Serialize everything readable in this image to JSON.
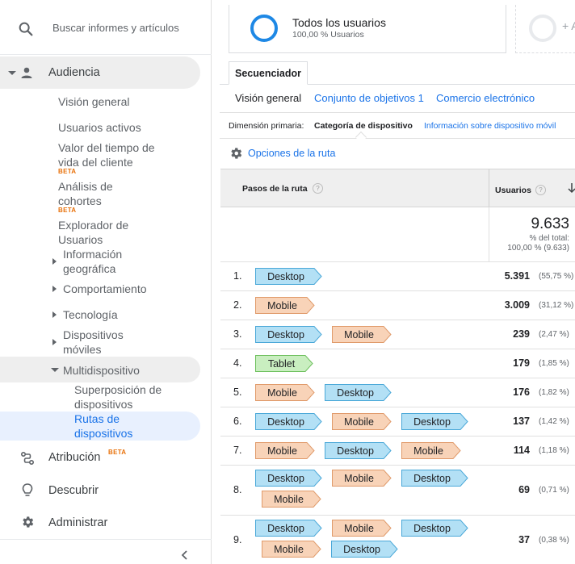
{
  "search": {
    "placeholder": "Buscar informes y artículos"
  },
  "sidebar": {
    "audiencia": "Audiencia",
    "items": [
      {
        "label": "Visión general"
      },
      {
        "label": "Usuarios activos"
      },
      {
        "label": "Valor del tiempo de vida del cliente",
        "beta": "BETA"
      },
      {
        "label": "Análisis de cohortes",
        "beta": "BETA"
      },
      {
        "label": "Explorador de Usuarios"
      },
      {
        "label": "Información geográfica"
      },
      {
        "label": "Comportamiento"
      },
      {
        "label": "Tecnología"
      },
      {
        "label": "Dispositivos móviles"
      },
      {
        "label": "Multidispositivo"
      },
      {
        "label": "Superposición de dispositivos"
      },
      {
        "label": "Rutas de dispositivos"
      }
    ],
    "atribucion": "Atribución",
    "atribucion_beta": "BETA",
    "descubrir": "Descubrir",
    "administrar": "Administrar"
  },
  "segment": {
    "name": "Todos los usuarios",
    "pct": "100,00 % Usuarios",
    "add": "+ A"
  },
  "tabs": {
    "main": "Secuenciador",
    "sub": [
      "Visión general",
      "Conjunto de objetivos 1",
      "Comercio electrónico"
    ]
  },
  "dimension": {
    "label": "Dimensión primaria:",
    "active": "Categoría de dispositivo",
    "link": "Información sobre dispositivo móvil"
  },
  "route_options": "Opciones de la ruta",
  "table": {
    "col_path": "Pasos de la ruta",
    "col_users": "Usuarios",
    "help": "?",
    "sort_icon": "arrow-down",
    "total": {
      "value": "9.633",
      "pct_label": "% del total:",
      "pct_value": "100,00 % (9.633)"
    },
    "rows": [
      {
        "n": "1.",
        "steps": [
          "Desktop"
        ],
        "users": "5.391",
        "pct": "(55,75 %)"
      },
      {
        "n": "2.",
        "steps": [
          "Mobile"
        ],
        "users": "3.009",
        "pct": "(31,12 %)"
      },
      {
        "n": "3.",
        "steps": [
          "Desktop",
          "Mobile"
        ],
        "users": "239",
        "pct": "(2,47 %)"
      },
      {
        "n": "4.",
        "steps": [
          "Tablet"
        ],
        "users": "179",
        "pct": "(1,85 %)"
      },
      {
        "n": "5.",
        "steps": [
          "Mobile",
          "Desktop"
        ],
        "users": "176",
        "pct": "(1,82 %)"
      },
      {
        "n": "6.",
        "steps": [
          "Desktop",
          "Mobile",
          "Desktop"
        ],
        "users": "137",
        "pct": "(1,42 %)"
      },
      {
        "n": "7.",
        "steps": [
          "Mobile",
          "Desktop",
          "Mobile"
        ],
        "users": "114",
        "pct": "(1,18 %)"
      },
      {
        "n": "8.",
        "steps": [
          "Desktop",
          "Mobile",
          "Desktop",
          "Mobile"
        ],
        "users": "69",
        "pct": "(0,71 %)"
      },
      {
        "n": "9.",
        "steps": [
          "Desktop",
          "Mobile",
          "Desktop",
          "Mobile",
          "Desktop"
        ],
        "users": "37",
        "pct": "(0,38 %)"
      }
    ]
  },
  "colors": {
    "Desktop": {
      "fill": "#b3e0f5",
      "stroke": "#4aa8d8"
    },
    "Mobile": {
      "fill": "#f8d3b8",
      "stroke": "#e09a6a"
    },
    "Tablet": {
      "fill": "#c9eec0",
      "stroke": "#6cbf5c"
    }
  }
}
